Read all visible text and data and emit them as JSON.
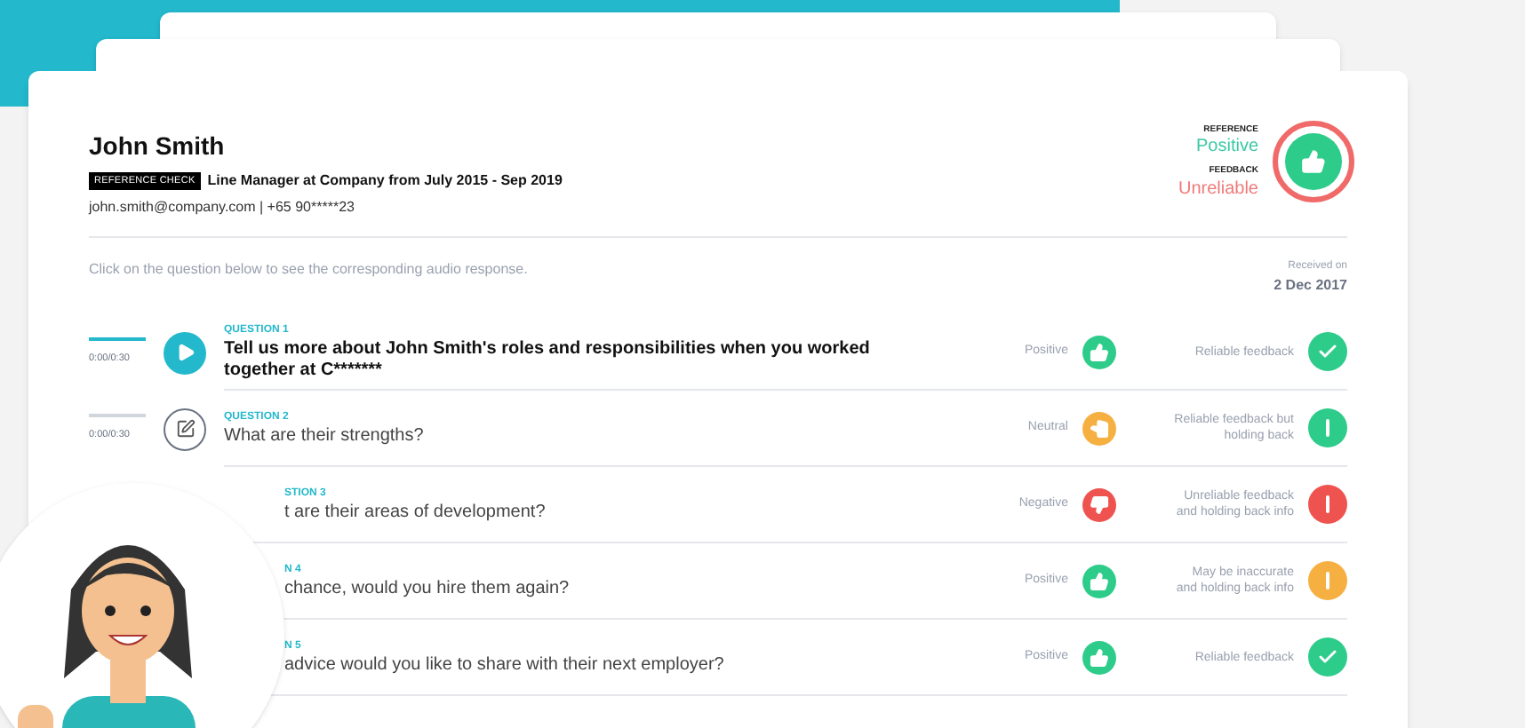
{
  "candidate": {
    "name": "John Smith",
    "badge": "REFERENCE CHECK",
    "role": "Line Manager at Company from July 2015 - Sep 2019",
    "contact": "john.smith@company.com | +65 90*****23"
  },
  "summary": {
    "reference_label": "REFERENCE",
    "reference_value": "Positive",
    "feedback_label": "FEEDBACK",
    "feedback_value": "Unreliable"
  },
  "instruction": "Click on the question below to see the corresponding audio response.",
  "received": {
    "label": "Received on",
    "date": "2 Dec 2017"
  },
  "questions": [
    {
      "kind": "audio",
      "selected": true,
      "time": "0:00/0:30",
      "number": "QUESTION 1",
      "text": "Tell us more about John Smith's roles and responsibilities when  you worked together at C*******",
      "sentiment": {
        "label": "Positive",
        "kind": "up",
        "color": "#2ecc8a"
      },
      "feedback": {
        "label": "Reliable feedback",
        "kind": "check",
        "color": "#2ecc8a"
      }
    },
    {
      "kind": "written",
      "selected": false,
      "time": "0:00/0:30",
      "number": "QUESTION 2",
      "text": "What are their strengths?",
      "sentiment": {
        "label": "Neutral",
        "kind": "neutral",
        "color": "#f5b041"
      },
      "feedback": {
        "label": "Reliable feedback but holding back",
        "kind": "alert",
        "color": "#2ecc8a"
      }
    },
    {
      "kind": "obscured",
      "selected": false,
      "number": "STION 3",
      "text": "t are their areas of development?",
      "sentiment": {
        "label": "Negative",
        "kind": "down",
        "color": "#ef5350"
      },
      "feedback": {
        "label": "Unreliable feedback and holding back info",
        "kind": "alert",
        "color": "#ef5350"
      }
    },
    {
      "kind": "obscured",
      "selected": false,
      "number": "N 4",
      "text": "chance, would you hire them again?",
      "sentiment": {
        "label": "Positive",
        "kind": "up",
        "color": "#2ecc8a"
      },
      "feedback": {
        "label": "May be inaccurate and holding back info",
        "kind": "alert",
        "color": "#f5b041"
      }
    },
    {
      "kind": "obscured",
      "selected": false,
      "number": "N 5",
      "text": "advice would you like to share with their next employer?",
      "sentiment": {
        "label": "Positive",
        "kind": "up",
        "color": "#2ecc8a"
      },
      "feedback": {
        "label": "Reliable feedback",
        "kind": "check",
        "color": "#2ecc8a"
      }
    }
  ]
}
